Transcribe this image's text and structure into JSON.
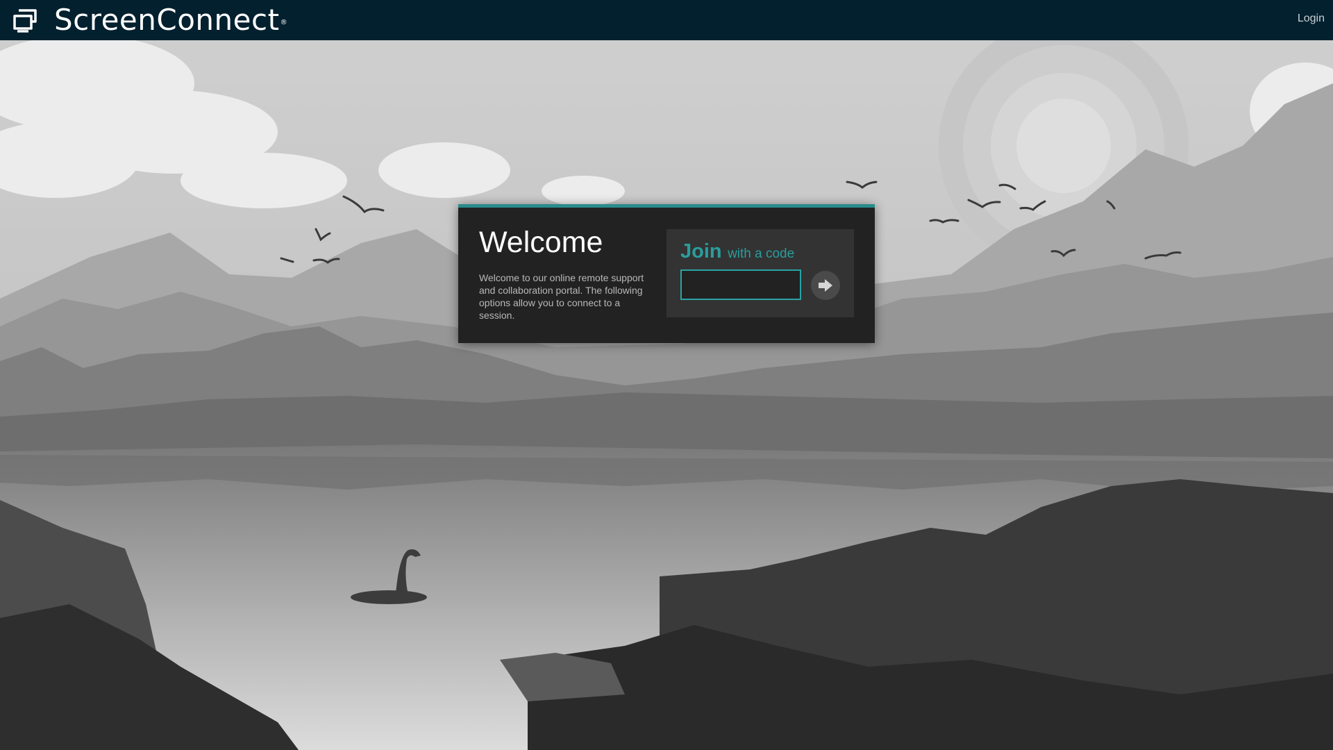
{
  "header": {
    "brand_name": "ScreenConnect",
    "brand_mark": "®",
    "login_label": "Login",
    "logo_icon": "screenconnect-logo-icon"
  },
  "welcome": {
    "title": "Welcome",
    "text": "Welcome to our online remote support and collaboration portal. The following options allow you to connect to a session."
  },
  "join": {
    "heading": "Join",
    "subheading": "with a code",
    "code_value": "",
    "code_placeholder": "",
    "submit_icon": "arrow-right-icon"
  },
  "colors": {
    "header_bg": "#02202e",
    "accent": "#2a9d9d",
    "panel_bg": "#222222",
    "join_bg": "#333333"
  }
}
